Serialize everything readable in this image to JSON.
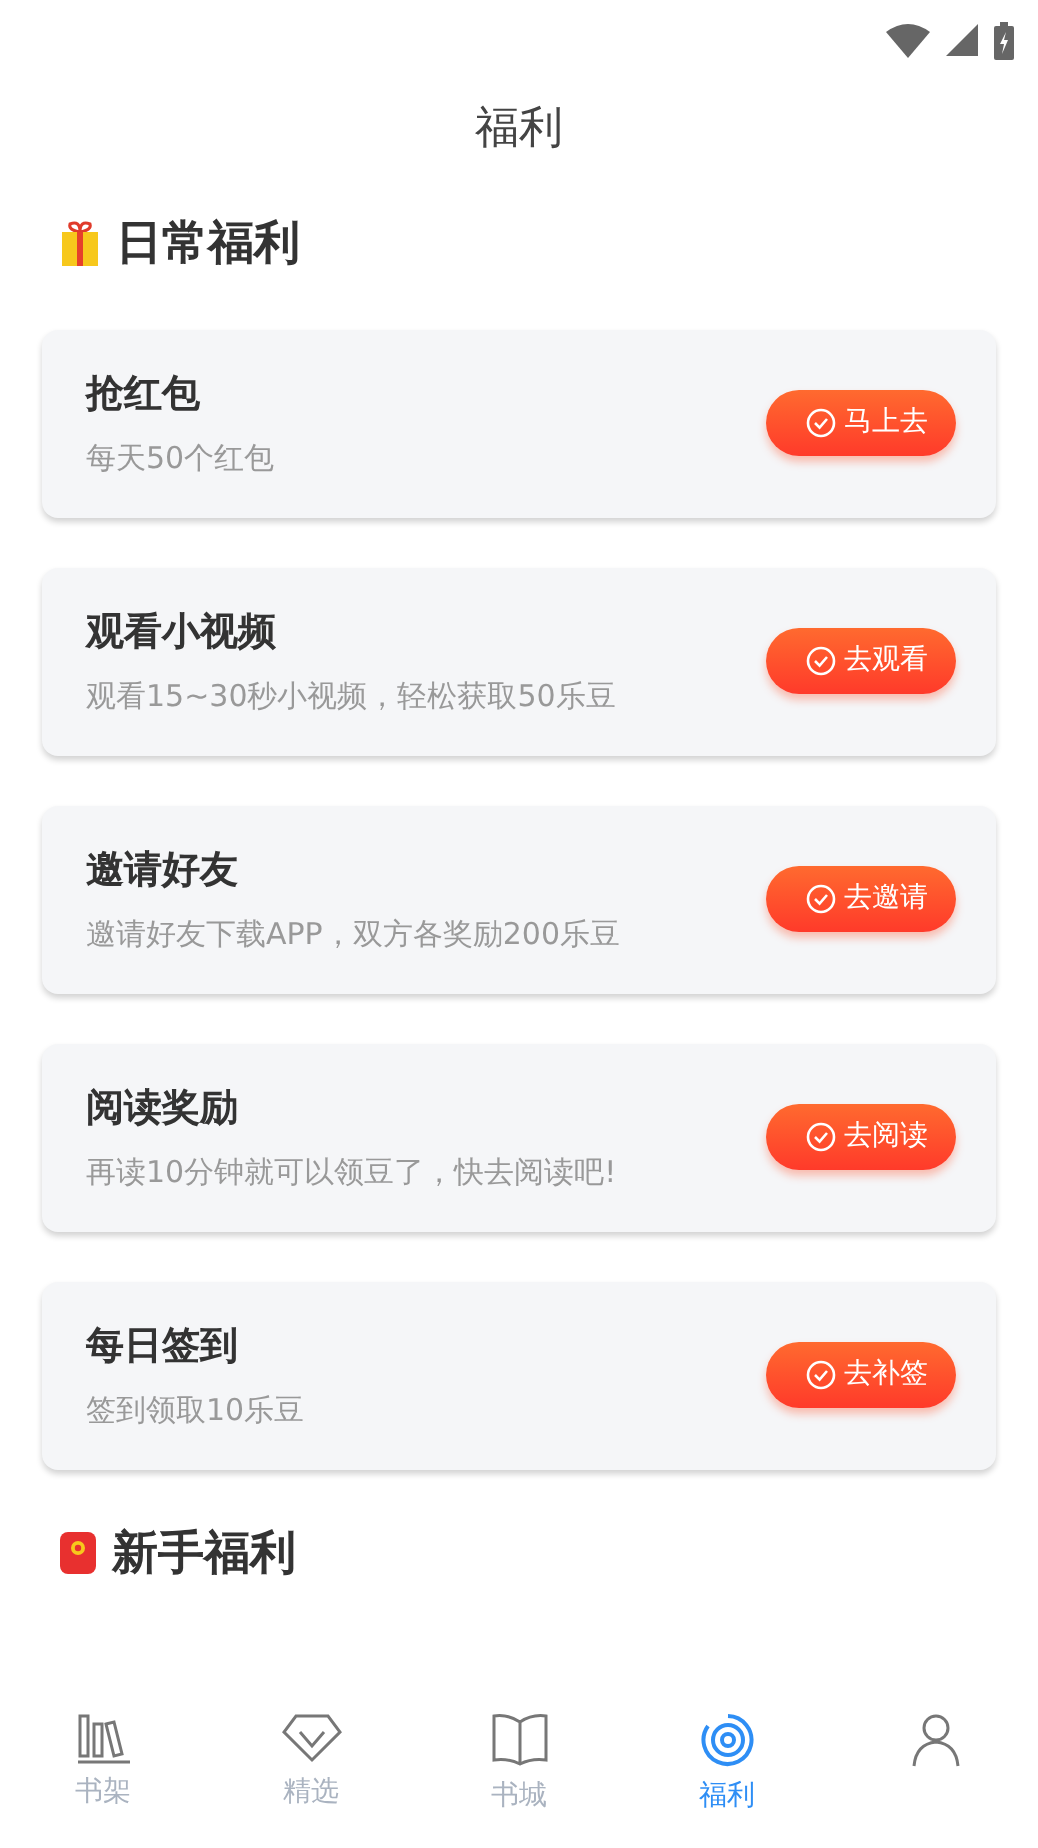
{
  "header": {
    "title": "福利"
  },
  "sections": [
    {
      "kind": "gift",
      "title": "日常福利",
      "tasks": [
        {
          "title": "抢红包",
          "desc": "每天50个红包",
          "action": "马上去"
        },
        {
          "title": "观看小视频",
          "desc": "观看15~30秒小视频，轻松获取50乐豆",
          "action": "去观看"
        },
        {
          "title": "邀请好友",
          "desc": "邀请好友下载APP，双方各奖励200乐豆",
          "action": "去邀请"
        },
        {
          "title": "阅读奖励",
          "desc": "再读10分钟就可以领豆了，快去阅读吧!",
          "action": "去阅读"
        },
        {
          "title": "每日签到",
          "desc": "签到领取10乐豆",
          "action": "去补签"
        }
      ]
    },
    {
      "kind": "envelope",
      "title": "新手福利"
    }
  ],
  "tabs": [
    {
      "kind": "shelf",
      "label": "书架",
      "selected": false
    },
    {
      "kind": "gem",
      "label": "精选",
      "selected": false
    },
    {
      "kind": "book",
      "label": "书城",
      "selected": false
    },
    {
      "kind": "target",
      "label": "福利",
      "selected": true
    },
    {
      "kind": "person",
      "selected": false
    }
  ]
}
